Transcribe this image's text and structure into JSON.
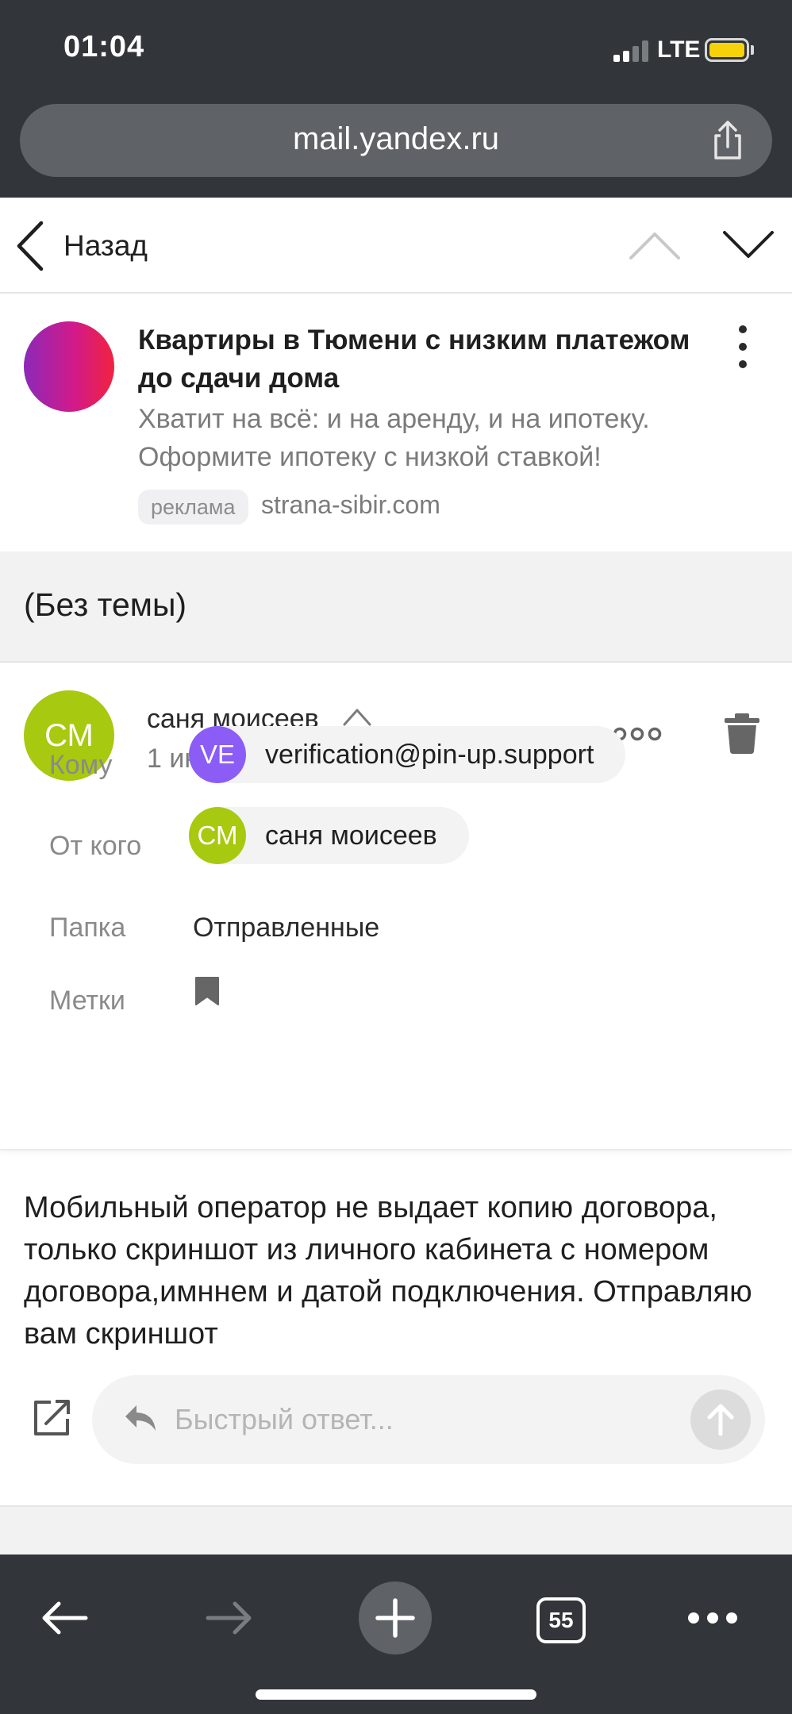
{
  "status_bar": {
    "time": "01:04",
    "network": "LTE"
  },
  "browser": {
    "url": "mail.yandex.ru",
    "tab_count": "55"
  },
  "nav": {
    "back_label": "Назад"
  },
  "ad": {
    "title": "Квартиры в Тюмени с низким платежом до сдачи дома",
    "description": "Хватит на всё: и на аренду, и на ипотеку. Оформите ипотеку с низкой ставкой!",
    "badge": "реклама",
    "domain": "strana-sibir.com",
    "logo_colors": [
      "#8b29b8",
      "#d21a8a",
      "#f0233f"
    ]
  },
  "message": {
    "subject": "(Без темы)",
    "sender": {
      "initials": "СМ",
      "name": "саня моисеев",
      "avatar_color": "#a7c90f"
    },
    "date": "1 июня в 13:42",
    "meta": {
      "to_label": "Кому",
      "to": {
        "initials": "VE",
        "email": "verification@pin-up.support",
        "avatar_color": "#8b5cf6"
      },
      "from_label": "От кого",
      "from": {
        "initials": "СМ",
        "name": "саня моисеев",
        "avatar_color": "#a7c90f"
      },
      "folder_label": "Папка",
      "folder": "Отправленные",
      "labels_label": "Метки"
    },
    "body": "Мобильный оператор не выдает копию договора, только скриншот из личного кабинета с номером договора,имннем и датой подключения. Отправляю вам скриншот"
  },
  "quick_reply": {
    "placeholder": "Быстрый ответ..."
  },
  "icons": [
    "share-icon",
    "back-chevron-icon",
    "chevron-up-icon",
    "chevron-down-icon",
    "kebab-menu-icon",
    "more-dots-icon",
    "trash-icon",
    "bookmark-icon",
    "compose-icon",
    "reply-arrow-icon",
    "send-arrow-icon",
    "arrow-left-icon",
    "arrow-right-icon",
    "plus-icon",
    "tabs-icon"
  ]
}
